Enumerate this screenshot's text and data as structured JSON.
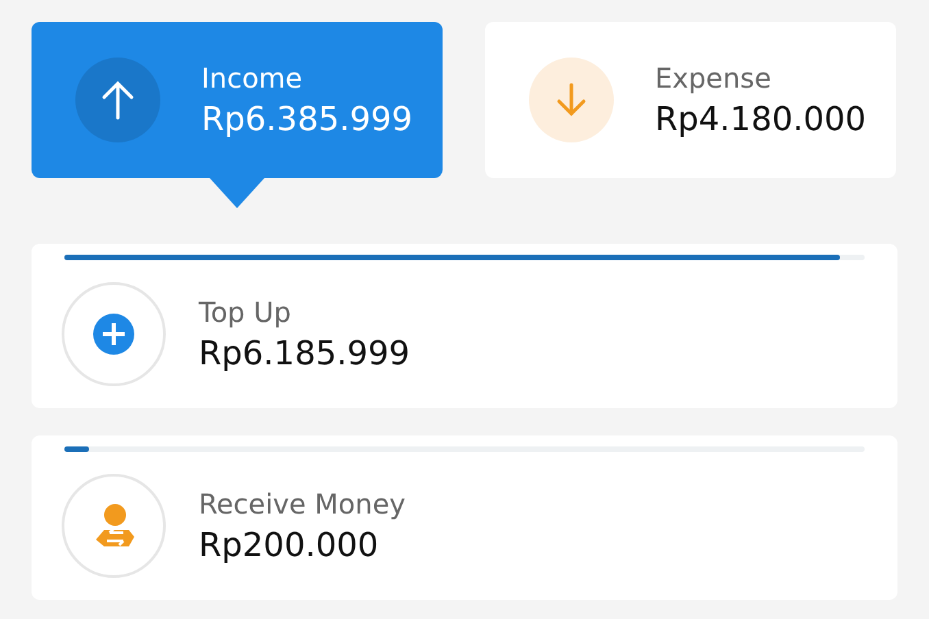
{
  "tabs": [
    {
      "kind": "income",
      "label": "Income",
      "amount": "Rp6.385.999",
      "selected": true
    },
    {
      "kind": "expense",
      "label": "Expense",
      "amount": "Rp4.180.000",
      "selected": false
    }
  ],
  "entries": [
    {
      "kind": "topup",
      "label": "Top Up",
      "amount": "Rp6.185.999",
      "level": 0.97
    },
    {
      "kind": "receive",
      "label": "Receive Money",
      "amount": "Rp200.000",
      "level": 0.03
    }
  ]
}
